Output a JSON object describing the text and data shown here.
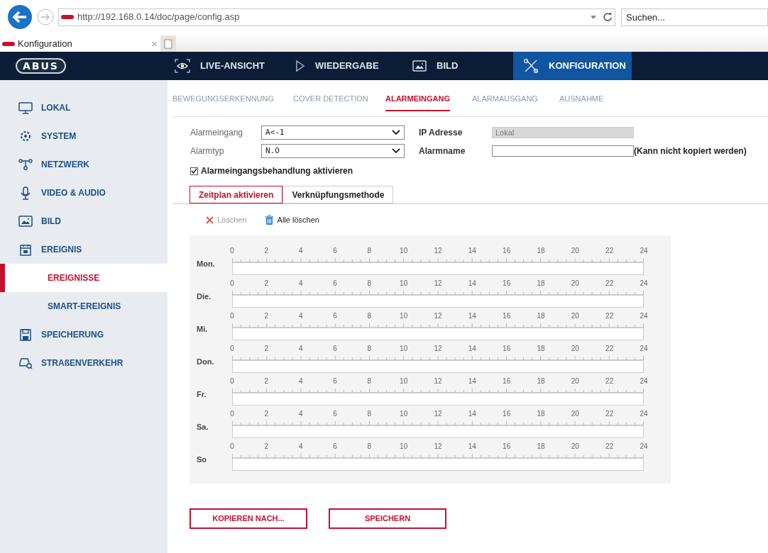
{
  "browser": {
    "url": "http://192.168.0.14/doc/page/config.asp",
    "search": {
      "placeholder": "Suchen..."
    },
    "tab": {
      "title": "Konfiguration"
    },
    "close_glyph": "×"
  },
  "nav": {
    "logo": "ABUS",
    "items": [
      {
        "label": "LIVE-ANSICHT",
        "kind": "eye",
        "selected": false
      },
      {
        "label": "WIEDERGABE",
        "kind": "play",
        "selected": false
      },
      {
        "label": "BILD",
        "kind": "image",
        "selected": false
      },
      {
        "label": "KONFIGURATION",
        "kind": "tools",
        "selected": true
      }
    ]
  },
  "sidebar": {
    "items": [
      {
        "label": "LOKAL",
        "kind": "monitor",
        "selected": false
      },
      {
        "label": "SYSTEM",
        "kind": "gear",
        "selected": false
      },
      {
        "label": "NETZWERK",
        "kind": "network",
        "selected": false
      },
      {
        "label": "VIDEO & AUDIO",
        "kind": "mic",
        "selected": false
      },
      {
        "label": "BILD",
        "kind": "image",
        "selected": false
      },
      {
        "label": "EREIGNIS",
        "kind": "calendar",
        "selected": false,
        "children": [
          {
            "label": "EREIGNISSE",
            "selected": true
          },
          {
            "label": "SMART-EREIGNIS",
            "selected": false
          }
        ]
      },
      {
        "label": "SPEICHERUNG",
        "kind": "disk",
        "selected": false
      },
      {
        "label": "STRAßENVERKEHR",
        "kind": "car",
        "selected": false
      }
    ]
  },
  "sub_tabs": [
    {
      "label": "BEWEGUNGSERKENNUNG",
      "selected": false
    },
    {
      "label": "COVER DETECTION",
      "selected": false
    },
    {
      "label": "ALARMEINGANG",
      "selected": true
    },
    {
      "label": "ALARMAUSGANG",
      "selected": false
    },
    {
      "label": "AUSNAHME",
      "selected": false
    }
  ],
  "form": {
    "rows": [
      {
        "label": "Alarmeingang",
        "value": "A<-1",
        "field_label": "IP Adresse",
        "field_value": "Lokal",
        "field_disabled": true
      },
      {
        "label": "Alarmtyp",
        "value": "N.O",
        "field_label": "Alarmname",
        "field_disabled": false,
        "note": "(Kann nicht kopiert werden)"
      }
    ],
    "checkbox": {
      "label": "Alarmeingangsbehandlung aktivieren",
      "checked": true
    }
  },
  "schedule_tabs": [
    {
      "label": "Zeitplan aktivieren",
      "selected": true
    },
    {
      "label": "Verknüpfungsmethode",
      "selected": false
    }
  ],
  "toolbar": [
    {
      "label": "Löschen",
      "kind": "x",
      "disabled": true
    },
    {
      "label": "Alle löschen",
      "kind": "trash",
      "disabled": false
    }
  ],
  "schedule": {
    "days": [
      {
        "label": "Mon.",
        "hours": [
          "0",
          "2",
          "4",
          "6",
          "8",
          "10",
          "12",
          "14",
          "16",
          "18",
          "20",
          "22",
          "24"
        ]
      },
      {
        "label": "Die.",
        "hours": [
          "0",
          "2",
          "4",
          "6",
          "8",
          "10",
          "12",
          "14",
          "16",
          "18",
          "20",
          "22",
          "24"
        ]
      },
      {
        "label": "Mi.",
        "hours": [
          "0",
          "2",
          "4",
          "6",
          "8",
          "10",
          "12",
          "14",
          "16",
          "18",
          "20",
          "22",
          "24"
        ]
      },
      {
        "label": "Don.",
        "hours": [
          "0",
          "2",
          "4",
          "6",
          "8",
          "10",
          "12",
          "14",
          "16",
          "18",
          "20",
          "22",
          "24"
        ]
      },
      {
        "label": "Fr.",
        "hours": [
          "0",
          "2",
          "4",
          "6",
          "8",
          "10",
          "12",
          "14",
          "16",
          "18",
          "20",
          "22",
          "24"
        ]
      },
      {
        "label": "Sa.",
        "hours": [
          "0",
          "2",
          "4",
          "6",
          "8",
          "10",
          "12",
          "14",
          "16",
          "18",
          "20",
          "22",
          "24"
        ]
      },
      {
        "label": "So",
        "hours": [
          "0",
          "2",
          "4",
          "6",
          "8",
          "10",
          "12",
          "14",
          "16",
          "18",
          "20",
          "22",
          "24"
        ]
      }
    ]
  },
  "buttons": [
    "KOPIEREN NACH...",
    "SPEICHERN"
  ]
}
